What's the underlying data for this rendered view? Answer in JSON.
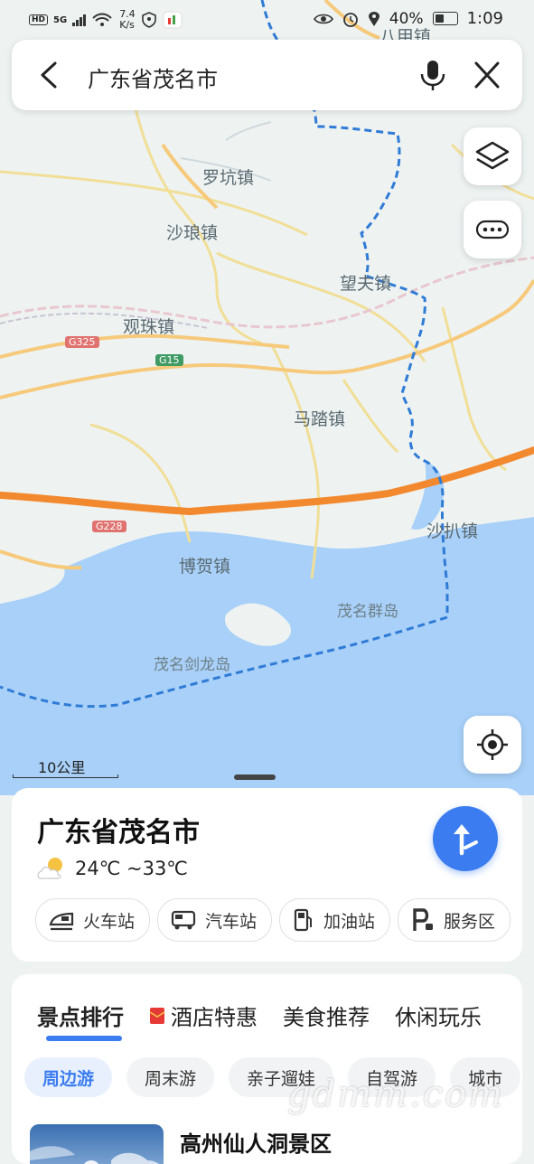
{
  "status_bar": {
    "left_badges": [
      "HD",
      "5G"
    ],
    "net_speed": "7.4",
    "net_unit": "K/s",
    "battery_pct": "40%",
    "time": "1:09"
  },
  "search": {
    "query": "广东省茂名市"
  },
  "map": {
    "labels": {
      "bajia": "八甲镇",
      "luokeng": "罗坑镇",
      "shalang": "沙琅镇",
      "wangfu": "望夫镇",
      "guanzhu": "观珠镇",
      "mata": "马踏镇",
      "shaba": "沙扒镇",
      "bohe": "博贺镇",
      "islands": "茂名群岛",
      "jianlong": "茂名剑龙岛"
    },
    "roads": {
      "g325": "G325",
      "g15": "G15",
      "g228": "G228"
    },
    "scale_label": "10公里",
    "colors": {
      "land": "#eef3f2",
      "sea": "#a8d0f8",
      "highway": "#f3892e",
      "border": "#2f7bd6"
    }
  },
  "place_card": {
    "title": "广东省茂名市",
    "weather": "24℃ ~33℃",
    "poi_buttons": [
      {
        "label": "火车站",
        "icon": "train-icon"
      },
      {
        "label": "汽车站",
        "icon": "bus-icon"
      },
      {
        "label": "加油站",
        "icon": "fuel-icon"
      },
      {
        "label": "服务区",
        "icon": "parking-icon"
      }
    ]
  },
  "explore": {
    "tabs": [
      "景点排行",
      "酒店特惠",
      "美食推荐",
      "休闲玩乐"
    ],
    "chips": [
      "周边游",
      "周末游",
      "亲子遛娃",
      "自驾游",
      "城市"
    ],
    "result_title": "高州仙人洞景区"
  },
  "watermark": "gdmm.com"
}
